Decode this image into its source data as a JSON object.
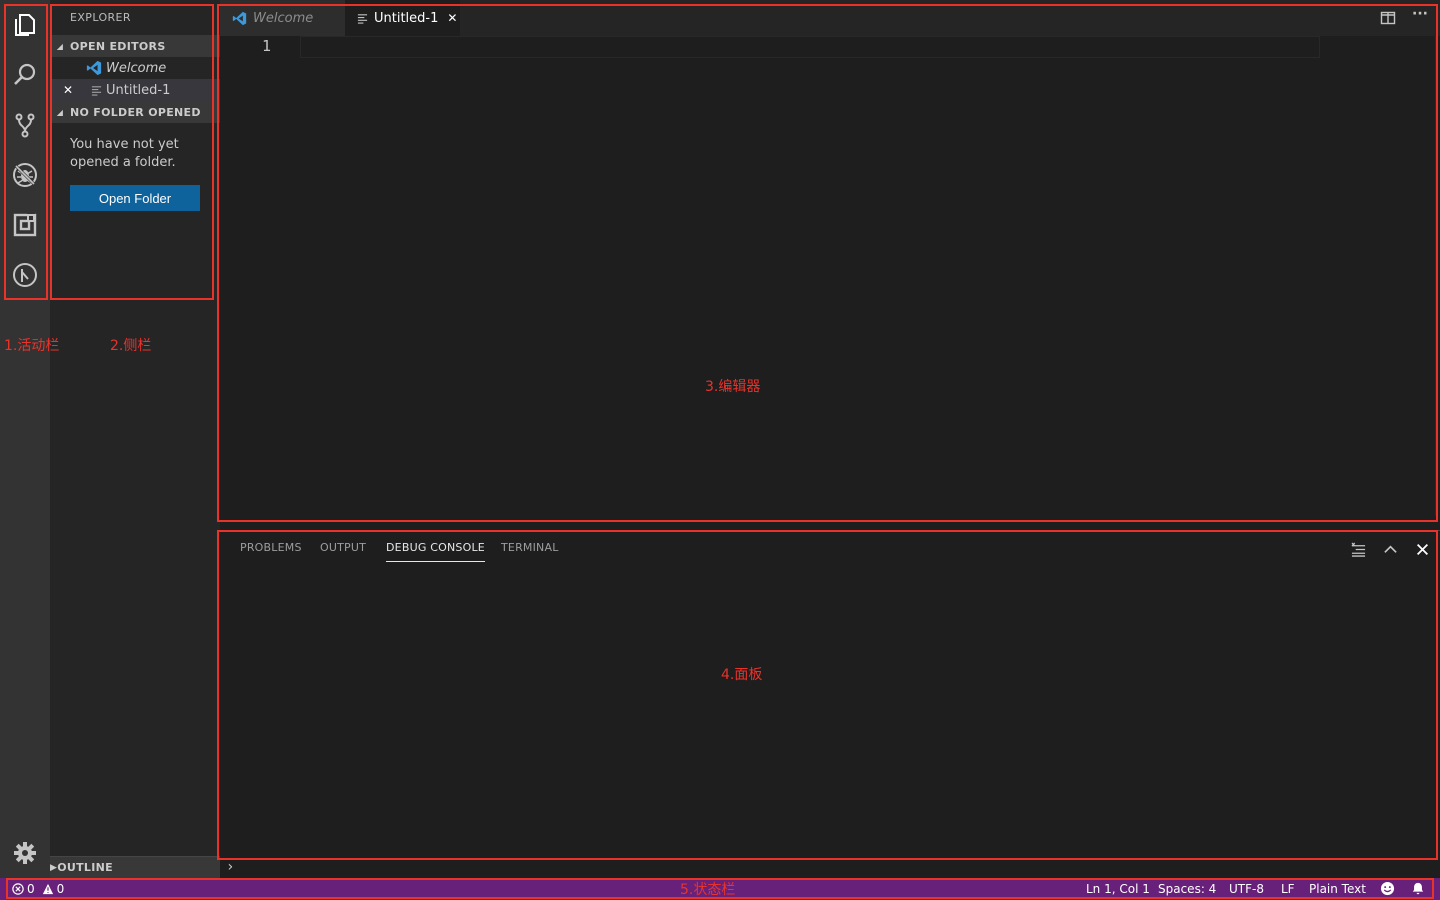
{
  "sidebar": {
    "title": "EXPLORER",
    "open_editors_header": "OPEN EDITORS",
    "open_editors": [
      {
        "label": "Welcome"
      },
      {
        "label": "Untitled-1"
      }
    ],
    "no_folder_header": "NO FOLDER OPENED",
    "no_folder_message": "You have not yet opened a folder.",
    "open_folder_button": "Open Folder",
    "outline_header": "OUTLINE"
  },
  "editor": {
    "tabs": [
      {
        "label": "Welcome"
      },
      {
        "label": "Untitled-1"
      }
    ],
    "line_number": "1"
  },
  "panel": {
    "tabs": [
      "PROBLEMS",
      "OUTPUT",
      "DEBUG CONSOLE",
      "TERMINAL"
    ],
    "active_tab": "DEBUG CONSOLE",
    "repl_prompt": "›"
  },
  "statusbar": {
    "errors": "0",
    "warnings": "0",
    "position": "Ln 1, Col 1",
    "spaces": "Spaces: 4",
    "encoding": "UTF-8",
    "eol": "LF",
    "language": "Plain Text"
  },
  "annotations": {
    "activity_bar": "1.活动栏",
    "sidebar": "2.侧栏",
    "editor": "3.编辑器",
    "panel": "4.面板",
    "status_bar": "5.状态栏"
  },
  "colors": {
    "status_bar": "#68217a",
    "annotation": "#e8332b",
    "button": "#0e639c",
    "vscode_blue": "#3c99dc"
  },
  "icons": {
    "activity_bar": [
      "explorer-icon",
      "search-icon",
      "source-control-icon",
      "debug-icon",
      "extensions-icon",
      "remote-icon",
      "settings-gear-icon"
    ]
  }
}
